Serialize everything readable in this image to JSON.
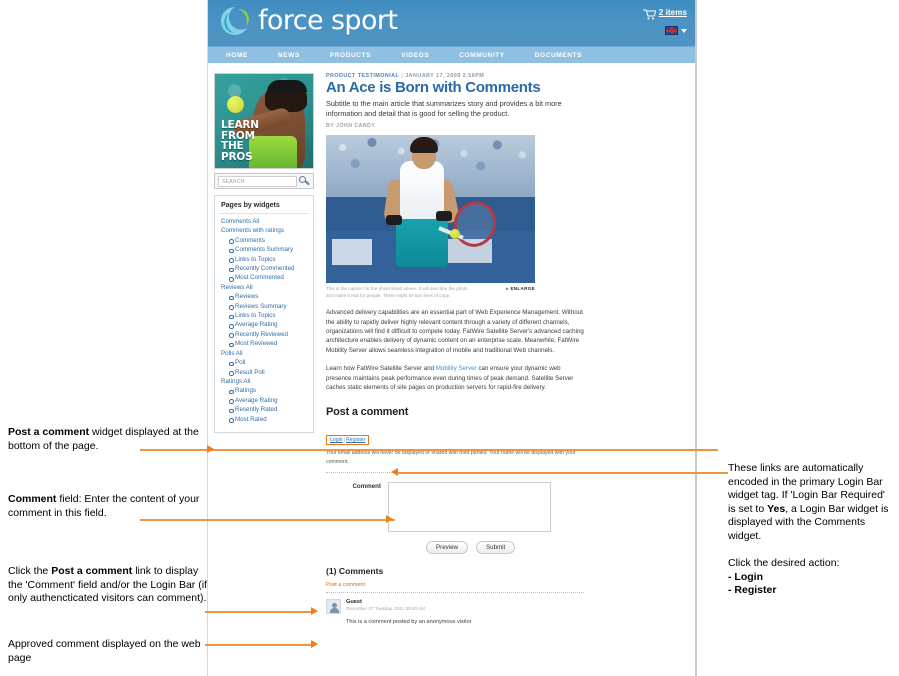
{
  "site": {
    "brand": "force sport",
    "cart_label": "2 items",
    "nav": [
      "HOME",
      "NEWS",
      "PRODUCTS",
      "VIDEOS",
      "COMMUNITY",
      "DOCUMENTS"
    ]
  },
  "sidebar": {
    "promo_text_lines": [
      "LEARN",
      "FROM",
      "THE",
      "PROS"
    ],
    "search_placeholder": "SEARCH",
    "widgets_title": "Pages by widgets",
    "groups": [
      {
        "label": "Comments All",
        "items": []
      },
      {
        "label": "Comments with ratings",
        "items": [
          "Comments",
          "Comments Summary",
          "Links to Topics",
          "Recently Commented",
          "Most Commented"
        ]
      },
      {
        "label": "Reviews All",
        "items": []
      },
      {
        "label": "",
        "items": [
          "Reviews",
          "Reviews Summary",
          "Links to Topics",
          "Average Rating",
          "Recently Reviewed",
          "Most Reviewed"
        ]
      },
      {
        "label": "Polls All",
        "items": [
          "Poll",
          "Result Poll"
        ]
      },
      {
        "label": "Ratings All",
        "items": [
          "Ratings",
          "Average Rating",
          "Resently Rated",
          "Most Rated"
        ]
      }
    ]
  },
  "article": {
    "kicker": "PRODUCT TESTIMONIAL",
    "date": "JANUARY 17, 2009 2:56PM",
    "headline": "An Ace is Born with Comments",
    "subtitle": "Subtitle to the main article that summarizes story and provides a bit more information and detail that is good for selling the product.",
    "byline": "BY JOHN CANDY",
    "photo_caption": "This is the caption for the photo listed above. It will describe the photo and make it real for people. There might be two lines of copy.",
    "enlarge_label": "ENLARGE",
    "para1": "Advanced delivery capabilities are an essential part of Web Experience Management. Without the ability to rapidly deliver highly relevant content through a variety of different channels, organizations will find it difficult to compete today. FatWire Satellite Server's advanced caching architecture enables delivery of dynamic content on an enterprise scale. Meanwhile, FatWire Mobility Server allows seamless integration of mobile and traditional Web channels.",
    "para2_before": "Learn how FatWire Satellite Server and ",
    "para2_link": "Mobility Server",
    "para2_after": " can ensure your dynamic web presence maintains peak performance even during times of peak demand. Satellite Server caches static elements of site pages on production servers for rapid-fire delivery."
  },
  "comments": {
    "section_title": "Post a comment",
    "login_label": "Login",
    "register_label": "Register",
    "privacy_note": "Your email address will never be displayed or shared with third parties. Your name will be displayed with your comment.",
    "comment_field_label": "Comment",
    "comment_value": "",
    "preview_button": "Preview",
    "submit_button": "Submit",
    "count_title": "(1) Comments",
    "post_link": "Post a comment",
    "entries": [
      {
        "author": "Guest",
        "date": "December 27 Tuesday, 2011 09:40 AM",
        "text": "This is a comment posted by an anonymous visitor"
      }
    ]
  },
  "annotations": {
    "left": [
      {
        "bold": "Post a comment",
        "rest": " widget displayed at the bottom of the page."
      },
      {
        "bold": "Comment",
        "rest": " field: Enter the content of your comment in this field."
      },
      {
        "pre": "Click the ",
        "bold": "Post a comment",
        "rest": " link to display the 'Comment' field and/or the Login Bar (if only authencticated visitors can comment)."
      },
      {
        "bold": "",
        "rest": "Approved comment displayed on the web page"
      }
    ],
    "right": {
      "para_a": "These links are automatically encoded in the primary Login Bar widget tag. If 'Login Bar Required' is set to ",
      "para_a_bold": "Yes",
      "para_a_end": ", a Login Bar widget is displayed with the Comments widget.",
      "para_b": "Click the desired action:",
      "item_1": "- Login",
      "item_2": "- Register"
    }
  }
}
